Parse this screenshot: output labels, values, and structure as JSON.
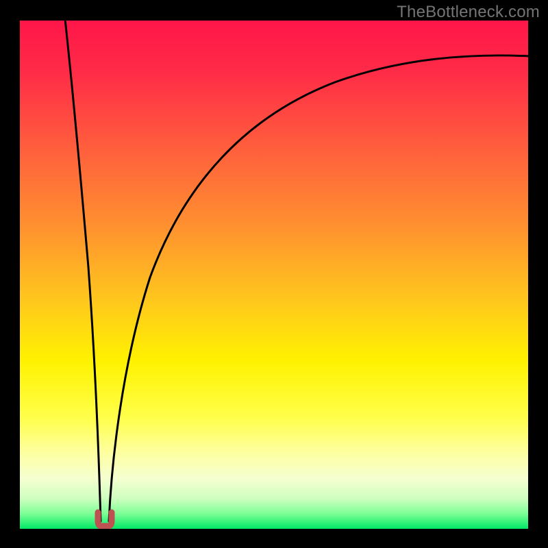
{
  "watermark": {
    "text": "TheBottleneck.com"
  },
  "chart_data": {
    "type": "line",
    "title": "",
    "xlabel": "",
    "ylabel": "",
    "xlim": [
      0,
      100
    ],
    "ylim": [
      0,
      100
    ],
    "series": [
      {
        "name": "left-descending-curve",
        "x": [
          9,
          10,
          11,
          12,
          13,
          14,
          15,
          15.9
        ],
        "y": [
          100,
          88,
          74,
          59,
          44,
          28,
          13,
          1.5
        ]
      },
      {
        "name": "right-ascending-curve",
        "x": [
          17.5,
          18,
          20,
          24,
          30,
          38,
          48,
          60,
          74,
          88,
          100
        ],
        "y": [
          1.5,
          9,
          28,
          48,
          63,
          73,
          80,
          85,
          89,
          91.5,
          93
        ]
      },
      {
        "name": "minimum-marker",
        "x": [
          15.4,
          15.4,
          15.8,
          16.6,
          17.4,
          17.8,
          17.8
        ],
        "y": [
          3.0,
          1.4,
          0.6,
          0.4,
          0.6,
          1.4,
          3.0
        ]
      }
    ],
    "colors": {
      "curve": "#000000",
      "marker": "#bd5252",
      "gradient_top": "#ff1649",
      "gradient_bottom": "#00e865"
    }
  }
}
